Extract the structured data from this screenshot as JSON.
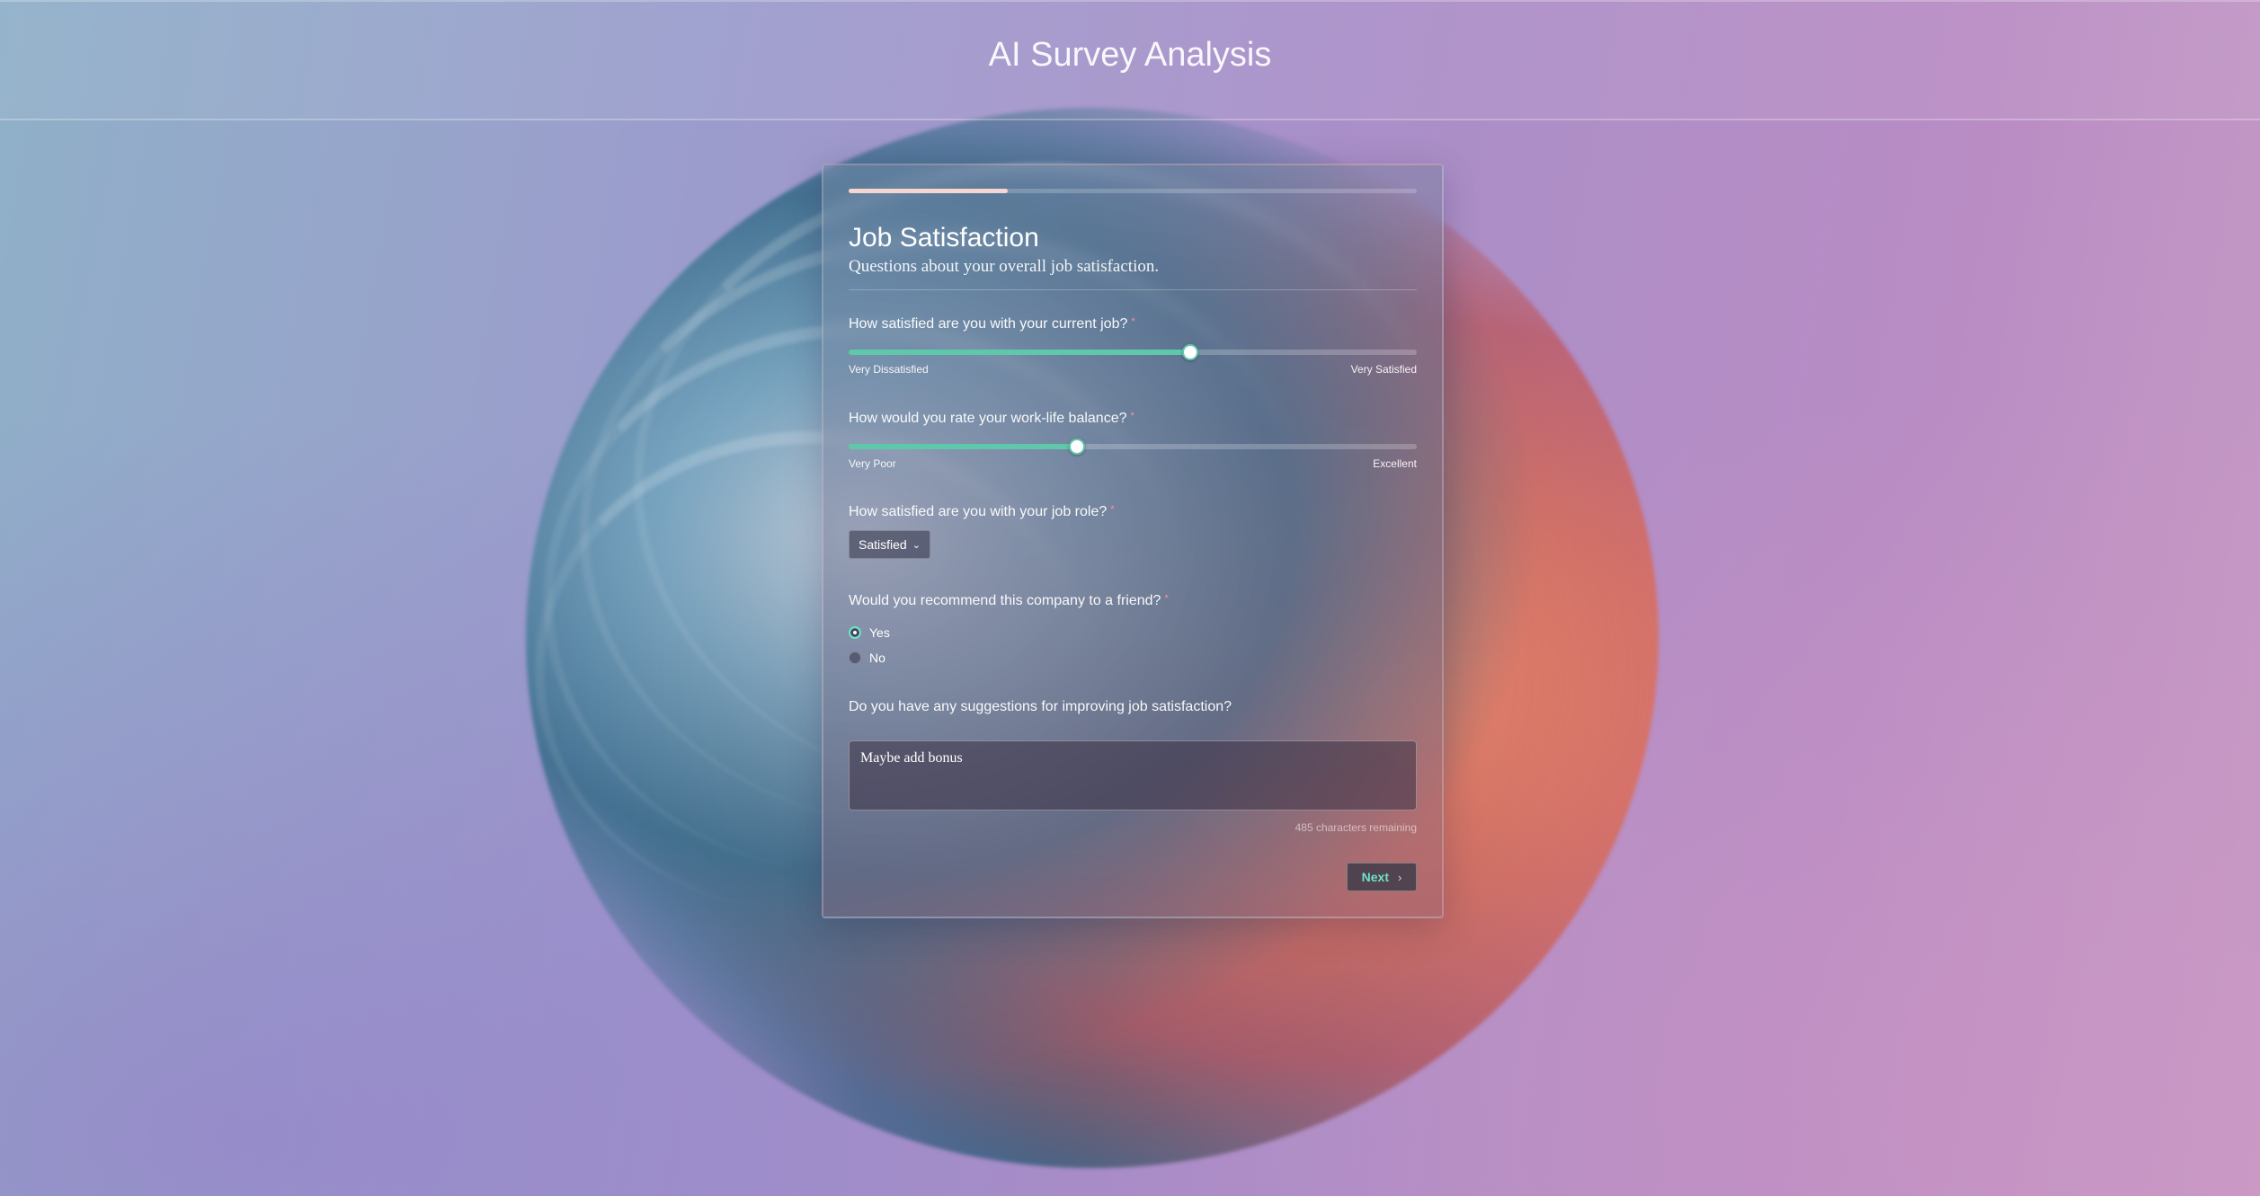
{
  "app": {
    "title": "AI Survey Analysis"
  },
  "progress": {
    "fraction": 0.28
  },
  "section": {
    "title": "Job Satisfaction",
    "description": "Questions about your overall job satisfaction."
  },
  "questions": {
    "job_satisfaction": {
      "label": "How satisfied are you with your current job?",
      "required_mark": "*",
      "min_label": "Very Dissatisfied",
      "max_label": "Very Satisfied",
      "value_fraction": 0.6
    },
    "work_life": {
      "label": "How would you rate your work-life balance?",
      "required_mark": "*",
      "min_label": "Very Poor",
      "max_label": "Excellent",
      "value_fraction": 0.4
    },
    "job_role": {
      "label": "How satisfied are you with your job role?",
      "required_mark": "*",
      "selected": "Satisfied"
    },
    "recommend": {
      "label": "Would you recommend this company to a friend?",
      "required_mark": "*",
      "options": [
        "Yes",
        "No"
      ],
      "selected": "Yes"
    },
    "suggestions": {
      "label": "Do you have any suggestions for improving job satisfaction?",
      "value": "Maybe add bonus",
      "chars_remaining": "485 characters remaining"
    }
  },
  "actions": {
    "next_label": "Next"
  },
  "colors": {
    "accent": "#5fc8aa",
    "progress": "#f7d6d0",
    "required": "#ff8fa0"
  }
}
